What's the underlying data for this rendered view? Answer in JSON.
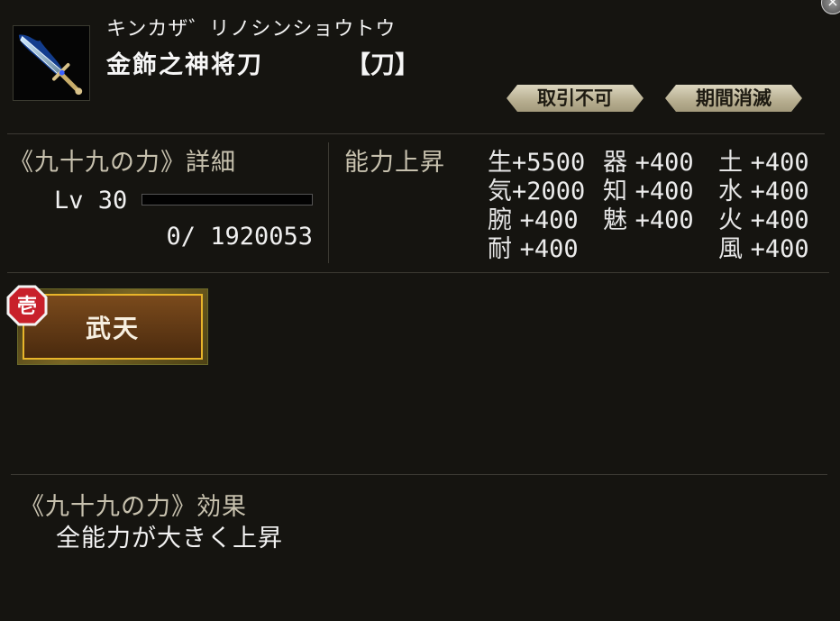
{
  "item": {
    "reading": "キンカザ゛リノシンショウトウ",
    "name": "金飾之神将刀",
    "type": "【刀】",
    "tags": [
      "取引不可",
      "期間消滅"
    ]
  },
  "power": {
    "title": "《九十九の力》詳細",
    "level_text": "Lv 30",
    "exp_text": "0/ 1920053",
    "exp_fraction": 0
  },
  "ability": {
    "title": "能力上昇",
    "stats": [
      {
        "k": "生",
        "v": "+5500"
      },
      {
        "k": "器",
        "v": "+400"
      },
      {
        "k": "土",
        "v": "+400"
      },
      {
        "k": "気",
        "v": "+2000"
      },
      {
        "k": "知",
        "v": "+400"
      },
      {
        "k": "水",
        "v": "+400"
      },
      {
        "k": "腕",
        "v": "+400"
      },
      {
        "k": "魅",
        "v": "+400"
      },
      {
        "k": "火",
        "v": "+400"
      },
      {
        "k": "耐",
        "v": "+400"
      },
      {
        "k": "風",
        "v": "+400"
      }
    ]
  },
  "skill": {
    "badge": "壱",
    "name": "武天"
  },
  "effect": {
    "title": "《九十九の力》効果",
    "description": "全能力が大きく上昇"
  },
  "close_label": "×",
  "colors": {
    "accent": "#e8b52a",
    "badge": "#c8202a",
    "panel": "#151410"
  }
}
